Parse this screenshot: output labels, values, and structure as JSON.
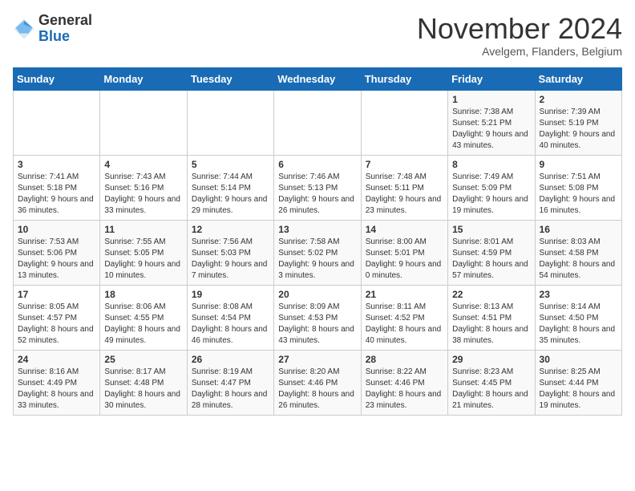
{
  "header": {
    "logo_general": "General",
    "logo_blue": "Blue",
    "month_title": "November 2024",
    "subtitle": "Avelgem, Flanders, Belgium"
  },
  "days_of_week": [
    "Sunday",
    "Monday",
    "Tuesday",
    "Wednesday",
    "Thursday",
    "Friday",
    "Saturday"
  ],
  "weeks": [
    [
      {
        "day": "",
        "info": ""
      },
      {
        "day": "",
        "info": ""
      },
      {
        "day": "",
        "info": ""
      },
      {
        "day": "",
        "info": ""
      },
      {
        "day": "",
        "info": ""
      },
      {
        "day": "1",
        "info": "Sunrise: 7:38 AM\nSunset: 5:21 PM\nDaylight: 9 hours and 43 minutes."
      },
      {
        "day": "2",
        "info": "Sunrise: 7:39 AM\nSunset: 5:19 PM\nDaylight: 9 hours and 40 minutes."
      }
    ],
    [
      {
        "day": "3",
        "info": "Sunrise: 7:41 AM\nSunset: 5:18 PM\nDaylight: 9 hours and 36 minutes."
      },
      {
        "day": "4",
        "info": "Sunrise: 7:43 AM\nSunset: 5:16 PM\nDaylight: 9 hours and 33 minutes."
      },
      {
        "day": "5",
        "info": "Sunrise: 7:44 AM\nSunset: 5:14 PM\nDaylight: 9 hours and 29 minutes."
      },
      {
        "day": "6",
        "info": "Sunrise: 7:46 AM\nSunset: 5:13 PM\nDaylight: 9 hours and 26 minutes."
      },
      {
        "day": "7",
        "info": "Sunrise: 7:48 AM\nSunset: 5:11 PM\nDaylight: 9 hours and 23 minutes."
      },
      {
        "day": "8",
        "info": "Sunrise: 7:49 AM\nSunset: 5:09 PM\nDaylight: 9 hours and 19 minutes."
      },
      {
        "day": "9",
        "info": "Sunrise: 7:51 AM\nSunset: 5:08 PM\nDaylight: 9 hours and 16 minutes."
      }
    ],
    [
      {
        "day": "10",
        "info": "Sunrise: 7:53 AM\nSunset: 5:06 PM\nDaylight: 9 hours and 13 minutes."
      },
      {
        "day": "11",
        "info": "Sunrise: 7:55 AM\nSunset: 5:05 PM\nDaylight: 9 hours and 10 minutes."
      },
      {
        "day": "12",
        "info": "Sunrise: 7:56 AM\nSunset: 5:03 PM\nDaylight: 9 hours and 7 minutes."
      },
      {
        "day": "13",
        "info": "Sunrise: 7:58 AM\nSunset: 5:02 PM\nDaylight: 9 hours and 3 minutes."
      },
      {
        "day": "14",
        "info": "Sunrise: 8:00 AM\nSunset: 5:01 PM\nDaylight: 9 hours and 0 minutes."
      },
      {
        "day": "15",
        "info": "Sunrise: 8:01 AM\nSunset: 4:59 PM\nDaylight: 8 hours and 57 minutes."
      },
      {
        "day": "16",
        "info": "Sunrise: 8:03 AM\nSunset: 4:58 PM\nDaylight: 8 hours and 54 minutes."
      }
    ],
    [
      {
        "day": "17",
        "info": "Sunrise: 8:05 AM\nSunset: 4:57 PM\nDaylight: 8 hours and 52 minutes."
      },
      {
        "day": "18",
        "info": "Sunrise: 8:06 AM\nSunset: 4:55 PM\nDaylight: 8 hours and 49 minutes."
      },
      {
        "day": "19",
        "info": "Sunrise: 8:08 AM\nSunset: 4:54 PM\nDaylight: 8 hours and 46 minutes."
      },
      {
        "day": "20",
        "info": "Sunrise: 8:09 AM\nSunset: 4:53 PM\nDaylight: 8 hours and 43 minutes."
      },
      {
        "day": "21",
        "info": "Sunrise: 8:11 AM\nSunset: 4:52 PM\nDaylight: 8 hours and 40 minutes."
      },
      {
        "day": "22",
        "info": "Sunrise: 8:13 AM\nSunset: 4:51 PM\nDaylight: 8 hours and 38 minutes."
      },
      {
        "day": "23",
        "info": "Sunrise: 8:14 AM\nSunset: 4:50 PM\nDaylight: 8 hours and 35 minutes."
      }
    ],
    [
      {
        "day": "24",
        "info": "Sunrise: 8:16 AM\nSunset: 4:49 PM\nDaylight: 8 hours and 33 minutes."
      },
      {
        "day": "25",
        "info": "Sunrise: 8:17 AM\nSunset: 4:48 PM\nDaylight: 8 hours and 30 minutes."
      },
      {
        "day": "26",
        "info": "Sunrise: 8:19 AM\nSunset: 4:47 PM\nDaylight: 8 hours and 28 minutes."
      },
      {
        "day": "27",
        "info": "Sunrise: 8:20 AM\nSunset: 4:46 PM\nDaylight: 8 hours and 26 minutes."
      },
      {
        "day": "28",
        "info": "Sunrise: 8:22 AM\nSunset: 4:46 PM\nDaylight: 8 hours and 23 minutes."
      },
      {
        "day": "29",
        "info": "Sunrise: 8:23 AM\nSunset: 4:45 PM\nDaylight: 8 hours and 21 minutes."
      },
      {
        "day": "30",
        "info": "Sunrise: 8:25 AM\nSunset: 4:44 PM\nDaylight: 8 hours and 19 minutes."
      }
    ]
  ]
}
